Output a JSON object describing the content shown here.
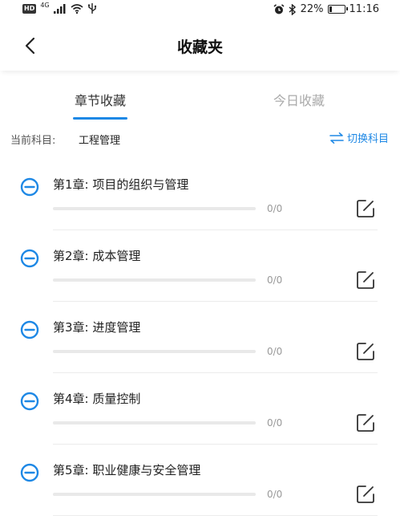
{
  "status_bar": {
    "hd": "HD",
    "network": "4G",
    "battery_percent": "22%",
    "battery_level": 0.22,
    "time": "11:16"
  },
  "header": {
    "title": "收藏夹"
  },
  "tabs": [
    {
      "label": "章节收藏",
      "active": true
    },
    {
      "label": "今日收藏",
      "active": false
    }
  ],
  "subject": {
    "label": "当前科目:",
    "value": "工程管理",
    "switch_label": "切换科目"
  },
  "colors": {
    "accent": "#1e88e5"
  },
  "chapters": [
    {
      "title": "第1章:  项目的组织与管理",
      "progress": "0/0",
      "fraction": 0
    },
    {
      "title": "第2章:  成本管理",
      "progress": "0/0",
      "fraction": 0
    },
    {
      "title": "第3章:  进度管理",
      "progress": "0/0",
      "fraction": 0
    },
    {
      "title": "第4章:  质量控制",
      "progress": "0/0",
      "fraction": 0
    },
    {
      "title": "第5章:  职业健康与安全管理",
      "progress": "0/0",
      "fraction": 0
    }
  ]
}
